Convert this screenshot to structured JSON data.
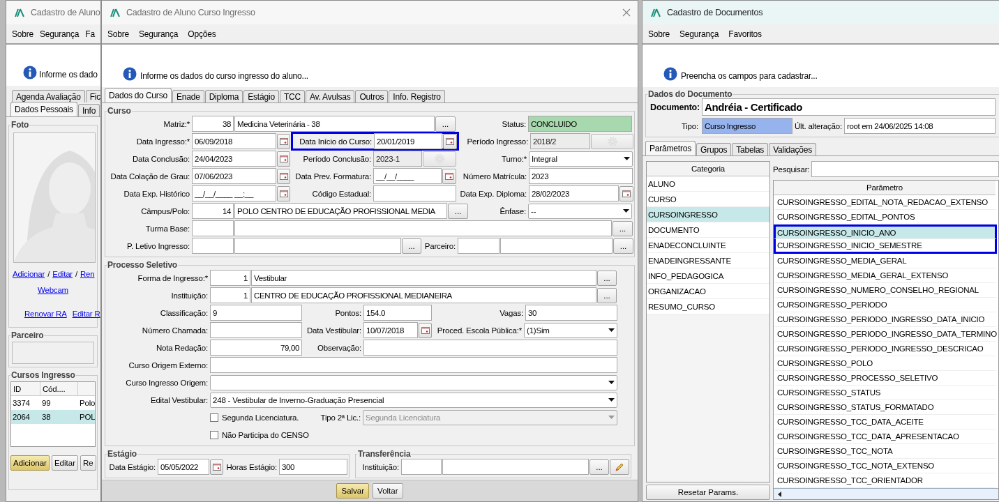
{
  "left_window": {
    "title": "Cadastro de Aluno",
    "menu": [
      "Sobre",
      "Segurança",
      "Fa"
    ],
    "info": "Informe os dado",
    "tabs": [
      [
        {
          "label": "Agenda Avaliação",
          "selected": false
        },
        {
          "label": "Fic",
          "selected": false
        }
      ],
      [
        {
          "label": "Dados Pessoais",
          "selected": true
        },
        {
          "label": "Info",
          "selected": false
        }
      ]
    ],
    "photo": {
      "title": "Foto",
      "links": [
        {
          "kind": "link",
          "text": "Adicionar"
        },
        {
          "kind": "sep",
          "text": "/"
        },
        {
          "kind": "link",
          "text": "Editar"
        },
        {
          "kind": "sep",
          "text": "/"
        },
        {
          "kind": "link",
          "text": "Ren"
        }
      ],
      "webcam": "Webcam",
      "links2": [
        "Renovar RA",
        "Editar R"
      ]
    },
    "partner": {
      "title": "Parceiro"
    },
    "courses": {
      "title": "Cursos Ingresso",
      "columns": [
        "ID",
        "Cód...."
      ],
      "rows": [
        {
          "cells": [
            "3374",
            "99",
            "Polo"
          ],
          "selected": false
        },
        {
          "cells": [
            "2064",
            "38",
            "POL"
          ],
          "selected": true
        }
      ],
      "buttons": [
        {
          "label": "Adicionar",
          "kind": "primary"
        },
        {
          "label": "Editar",
          "kind": "normal"
        },
        {
          "label": "Re",
          "kind": "normal"
        }
      ]
    }
  },
  "main_window": {
    "title": "Cadastro de Aluno Curso Ingresso",
    "menu": [
      "Sobre",
      "Segurança",
      "Opções"
    ],
    "info": "Informe os dados do curso ingresso do aluno...",
    "tabs": [
      {
        "label": "Dados do Curso",
        "selected": true
      },
      {
        "label": "Enade",
        "selected": false
      },
      {
        "label": "Diploma",
        "selected": false
      },
      {
        "label": "Estágio",
        "selected": false
      },
      {
        "label": "TCC",
        "selected": false
      },
      {
        "label": "Av. Avulsas",
        "selected": false
      },
      {
        "label": "Outros",
        "selected": false
      },
      {
        "label": "Info. Registro",
        "selected": false
      }
    ],
    "sections": [
      {
        "title": "Curso",
        "rows": [
          {
            "left": {
              "label": "Matriz:*",
              "controls": [
                {
                  "kind": "number",
                  "value": "38",
                  "disabled": false
                },
                {
                  "kind": "input",
                  "value": "Medicina Veterinária - 38",
                  "disabled": false
                },
                {
                  "kind": "browse",
                  "text": "..."
                }
              ]
            },
            "right": {
              "label": "Status:",
              "controls": [
                {
                  "kind": "status",
                  "value": "CONCLUIDO"
                }
              ]
            }
          },
          {
            "left": {
              "label": "Data Ingresso:*",
              "controls": [
                {
                  "kind": "input",
                  "value": "06/09/2018",
                  "disabled": false
                },
                {
                  "kind": "calendar"
                }
              ]
            },
            "middle": {
              "label": "Data Início do Curso:",
              "highlighted": true,
              "controls": [
                {
                  "kind": "input",
                  "value": "20/01/2019",
                  "disabled": false
                },
                {
                  "kind": "calendar"
                }
              ]
            },
            "right": {
              "label": "Período Ingresso:",
              "controls": [
                {
                  "kind": "input",
                  "value": "2018/2",
                  "disabled": true
                },
                {
                  "kind": "gear",
                  "disabled": true
                }
              ]
            }
          },
          {
            "left": {
              "label": "Data Conclusão:",
              "controls": [
                {
                  "kind": "input",
                  "value": "24/04/2023",
                  "disabled": false
                },
                {
                  "kind": "calendar"
                }
              ]
            },
            "middle": {
              "label": "Período Conclusão:",
              "controls": [
                {
                  "kind": "input",
                  "value": "2023-1",
                  "disabled": true
                },
                {
                  "kind": "gear",
                  "disabled": true
                }
              ]
            },
            "right": {
              "label": "Turno:*",
              "controls": [
                {
                  "kind": "select",
                  "value": "Integral",
                  "disabled": false
                }
              ]
            }
          },
          {
            "left": {
              "label": "Data Colação de Grau:",
              "controls": [
                {
                  "kind": "input",
                  "value": "07/06/2023",
                  "disabled": false
                },
                {
                  "kind": "calendar"
                }
              ]
            },
            "middle": {
              "label": "Data Prev. Formatura:",
              "controls": [
                {
                  "kind": "input",
                  "value": "__/__/____",
                  "disabled": false
                },
                {
                  "kind": "calendar"
                }
              ]
            },
            "right": {
              "label": "Número Matrícula:",
              "controls": [
                {
                  "kind": "input",
                  "value": "2023",
                  "disabled": false
                }
              ]
            }
          },
          {
            "left": {
              "label": "Data Exp. Histórico",
              "controls": [
                {
                  "kind": "input",
                  "value": "__/__/____ __:__",
                  "disabled": false
                },
                {
                  "kind": "calendar"
                }
              ]
            },
            "middle": {
              "label": "Código Estadual:",
              "controls": [
                {
                  "kind": "input",
                  "disabled": false
                }
              ]
            },
            "right": {
              "label": "Data Exp. Diploma:",
              "controls": [
                {
                  "kind": "input",
                  "value": "28/02/2023",
                  "disabled": false
                },
                {
                  "kind": "calendar"
                }
              ]
            }
          },
          {
            "left": {
              "label": "Câmpus/Polo:",
              "controls": [
                {
                  "kind": "number",
                  "value": "14",
                  "disabled": false
                },
                {
                  "kind": "input",
                  "value": "POLO CENTRO DE EDUCAÇÃO PROFISSIONAL MEDIA",
                  "disabled": false
                },
                {
                  "kind": "browse",
                  "text": "..."
                }
              ]
            },
            "right": {
              "label": "Ênfase:",
              "controls": [
                {
                  "kind": "select",
                  "value": "--",
                  "disabled": false
                }
              ]
            }
          },
          {
            "left": {
              "label": "Turma Base:",
              "controls": [
                {
                  "kind": "input",
                  "disabled": false
                },
                {
                  "kind": "input",
                  "disabled": false
                },
                {
                  "kind": "browse",
                  "text": "..."
                }
              ]
            }
          },
          {
            "left": {
              "label": "P. Letivo Ingresso:",
              "controls": [
                {
                  "kind": "input",
                  "disabled": false
                },
                {
                  "kind": "input",
                  "disabled": false
                },
                {
                  "kind": "browse",
                  "text": "..."
                }
              ]
            },
            "middle": {
              "label": "Parceiro:",
              "controls": [
                {
                  "kind": "input",
                  "disabled": false
                },
                {
                  "kind": "input",
                  "disabled": false
                },
                {
                  "kind": "browse",
                  "text": "..."
                }
              ]
            }
          }
        ]
      },
      {
        "title": "Processo Seletivo",
        "rows": [
          {
            "left": {
              "label": "Forma de Ingresso:*",
              "controls": [
                {
                  "kind": "number",
                  "value": "1",
                  "disabled": false
                },
                {
                  "kind": "input",
                  "value": "Vestibular",
                  "disabled": false
                },
                {
                  "kind": "browse",
                  "text": "..."
                }
              ]
            }
          },
          {
            "left": {
              "label": "Instituição:",
              "controls": [
                {
                  "kind": "number",
                  "value": "1",
                  "disabled": false
                },
                {
                  "kind": "input",
                  "value": "CENTRO DE EDUCAÇÃO PROFISSIONAL MEDIANEIRA",
                  "disabled": false
                },
                {
                  "kind": "browse",
                  "text": "..."
                }
              ]
            }
          },
          {
            "left": {
              "label": "Classificação:",
              "controls": [
                {
                  "kind": "input",
                  "value": "9",
                  "disabled": false
                }
              ]
            },
            "middle": {
              "label": "Pontos:",
              "controls": [
                {
                  "kind": "input",
                  "value": "154.0",
                  "disabled": false
                }
              ]
            },
            "right": {
              "label": "Vagas:",
              "controls": [
                {
                  "kind": "input",
                  "value": "30",
                  "disabled": false
                }
              ]
            }
          },
          {
            "left": {
              "label": "Número Chamada:",
              "controls": [
                {
                  "kind": "input",
                  "disabled": false
                }
              ]
            },
            "middle": {
              "label": "Data Vestibular:",
              "controls": [
                {
                  "kind": "input",
                  "value": "10/07/2018",
                  "disabled": false
                },
                {
                  "kind": "calendar"
                }
              ]
            },
            "right": {
              "label": "Proced. Escola Pública:*",
              "controls": [
                {
                  "kind": "select",
                  "value": "(1)Sim",
                  "disabled": false
                }
              ]
            }
          },
          {
            "left": {
              "label": "Nota Redação:",
              "controls": [
                {
                  "kind": "number",
                  "value": "79,00",
                  "disabled": false
                }
              ]
            },
            "middle": {
              "label": "Observação:",
              "controls": [
                {
                  "kind": "input",
                  "disabled": false
                }
              ]
            }
          },
          {
            "left": {
              "label": "Curso Origem Externo:",
              "controls": [
                {
                  "kind": "input",
                  "disabled": false
                }
              ]
            }
          },
          {
            "left": {
              "label": "Curso Ingresso Origem:",
              "controls": [
                {
                  "kind": "select",
                  "disabled": false
                }
              ]
            }
          },
          {
            "left": {
              "label": "Edital Vestibular:",
              "controls": [
                {
                  "kind": "select",
                  "value": "248 - Vestibular de Inverno-Graduação Presencial",
                  "disabled": false
                }
              ]
            }
          },
          {
            "left": {
              "controls": [
                {
                  "kind": "checkbox",
                  "label": "Segunda Licenciatura.",
                  "checked": false
                }
              ]
            },
            "middle": {
              "label": "Tipo 2ª Lic.:",
              "controls": [
                {
                  "kind": "select",
                  "value": "Segunda Licenciatura",
                  "disabled": true
                }
              ]
            }
          },
          {
            "left": {
              "controls": [
                {
                  "kind": "checkbox",
                  "label": "Não Participa do CENSO",
                  "checked": false
                }
              ]
            }
          }
        ]
      }
    ],
    "bottom_sections": [
      {
        "title": "Estágio",
        "rows": [
          {
            "left": {
              "label": "Data Estágio:",
              "controls": [
                {
                  "kind": "input",
                  "value": "05/05/2022",
                  "disabled": false
                },
                {
                  "kind": "calendar"
                }
              ]
            },
            "middle": {
              "label": "Horas Estágio:",
              "controls": [
                {
                  "kind": "input",
                  "value": "300",
                  "disabled": false
                }
              ]
            }
          }
        ]
      },
      {
        "title": "Transferência",
        "rows": [
          {
            "left": {
              "label": "Instituição:",
              "controls": [
                {
                  "kind": "input",
                  "disabled": false
                },
                {
                  "kind": "input",
                  "disabled": false
                },
                {
                  "kind": "browse",
                  "text": "..."
                },
                {
                  "kind": "edit"
                }
              ]
            }
          }
        ]
      }
    ],
    "buttons": [
      {
        "label": "Salvar",
        "kind": "primary"
      },
      {
        "label": "Voltar",
        "kind": "normal"
      }
    ]
  },
  "doc_window": {
    "title": "Cadastro de Documentos",
    "menu": [
      "Sobre",
      "Segurança",
      "Favoritos"
    ],
    "info": "Preencha os campos para cadastrar...",
    "group": {
      "title": "Dados do Documento",
      "document_label": "Documento:",
      "document": "Andréia - Certificado",
      "type_label": "Tipo:",
      "type": "Curso Ingresso",
      "changed_label": "Últ. alteração:",
      "changed": "root em 24/06/2025 14:08"
    },
    "tabs": [
      {
        "label": "Parâmetros",
        "selected": true
      },
      {
        "label": "Grupos",
        "selected": false
      },
      {
        "label": "Tabelas",
        "selected": false
      },
      {
        "label": "Validações",
        "selected": false
      }
    ],
    "category_header": "Categoria",
    "categories": [
      {
        "text": "ALUNO",
        "selected": false
      },
      {
        "text": "CURSO",
        "selected": false
      },
      {
        "text": "CURSOINGRESSO",
        "selected": true
      },
      {
        "text": "DOCUMENTO",
        "selected": false
      },
      {
        "text": "ENADECONCLUINTE",
        "selected": false
      },
      {
        "text": "ENADEINGRESSANTE",
        "selected": false
      },
      {
        "text": "INFO_PEDAGOGICA",
        "selected": false
      },
      {
        "text": "ORGANIZACAO",
        "selected": false
      },
      {
        "text": "RESUMO_CURSO",
        "selected": false
      }
    ],
    "reset_button": "Resetar Params.",
    "search_label": "Pesquisar:",
    "param_header": "Parâmetro",
    "params": [
      {
        "text": "CURSOINGRESSO_EDITAL_NOTA_REDACAO_EXTENSO",
        "selected": false,
        "highlighted": false
      },
      {
        "text": "CURSOINGRESSO_EDITAL_PONTOS",
        "selected": false,
        "highlighted": false
      },
      {
        "text": "CURSOINGRESSO_INICIO_ANO",
        "selected": true,
        "highlighted": true
      },
      {
        "text": "CURSOINGRESSO_INICIO_SEMESTRE",
        "selected": false,
        "highlighted": true
      },
      {
        "text": "CURSOINGRESSO_MEDIA_GERAL",
        "selected": false,
        "highlighted": false
      },
      {
        "text": "CURSOINGRESSO_MEDIA_GERAL_EXTENSO",
        "selected": false,
        "highlighted": false
      },
      {
        "text": "CURSOINGRESSO_NUMERO_CONSELHO_REGIONAL",
        "selected": false,
        "highlighted": false
      },
      {
        "text": "CURSOINGRESSO_PERIODO",
        "selected": false,
        "highlighted": false
      },
      {
        "text": "CURSOINGRESSO_PERIODO_INGRESSO_DATA_INICIO",
        "selected": false,
        "highlighted": false
      },
      {
        "text": "CURSOINGRESSO_PERIODO_INGRESSO_DATA_TERMINO",
        "selected": false,
        "highlighted": false
      },
      {
        "text": "CURSOINGRESSO_PERIODO_INGRESSO_DESCRICAO",
        "selected": false,
        "highlighted": false
      },
      {
        "text": "CURSOINGRESSO_POLO",
        "selected": false,
        "highlighted": false
      },
      {
        "text": "CURSOINGRESSO_PROCESSO_SELETIVO",
        "selected": false,
        "highlighted": false
      },
      {
        "text": "CURSOINGRESSO_STATUS",
        "selected": false,
        "highlighted": false
      },
      {
        "text": "CURSOINGRESSO_STATUS_FORMATADO",
        "selected": false,
        "highlighted": false
      },
      {
        "text": "CURSOINGRESSO_TCC_DATA_ACEITE",
        "selected": false,
        "highlighted": false
      },
      {
        "text": "CURSOINGRESSO_TCC_DATA_APRESENTACAO",
        "selected": false,
        "highlighted": false
      },
      {
        "text": "CURSOINGRESSO_TCC_NOTA",
        "selected": false,
        "highlighted": false
      },
      {
        "text": "CURSOINGRESSO_TCC_NOTA_EXTENSO",
        "selected": false,
        "highlighted": false
      },
      {
        "text": "CURSOINGRESSO_TCC_ORIENTADOR",
        "selected": false,
        "highlighted": false
      }
    ]
  }
}
